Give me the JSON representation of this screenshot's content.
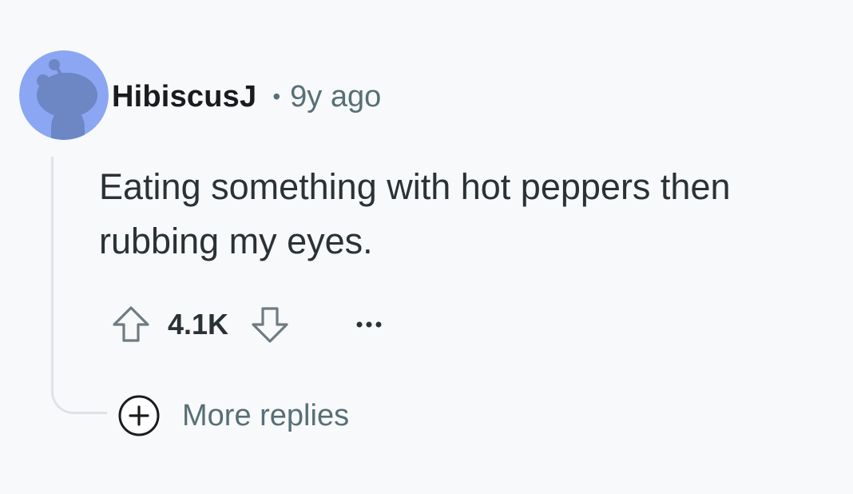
{
  "comment": {
    "author": "HibiscusJ",
    "separator": "•",
    "time_ago": "9y ago",
    "body": "Eating something with hot peppers then rubbing my eyes.",
    "score": "4.1K",
    "more_replies_label": "More replies"
  },
  "icons": {
    "avatar": "snoo-avatar-icon",
    "upvote": "arrow-up-outline-icon",
    "downvote": "arrow-down-outline-icon",
    "overflow": "ellipsis-horizontal-icon",
    "expand": "plus-circle-icon"
  },
  "colors": {
    "background": "#f8f9fb",
    "avatar_bg": "#8ba6f3",
    "avatar_figure": "#6d86c4",
    "meta_text": "#576f76",
    "body_text": "#2a3236",
    "thread_line": "#dfe3e8"
  }
}
